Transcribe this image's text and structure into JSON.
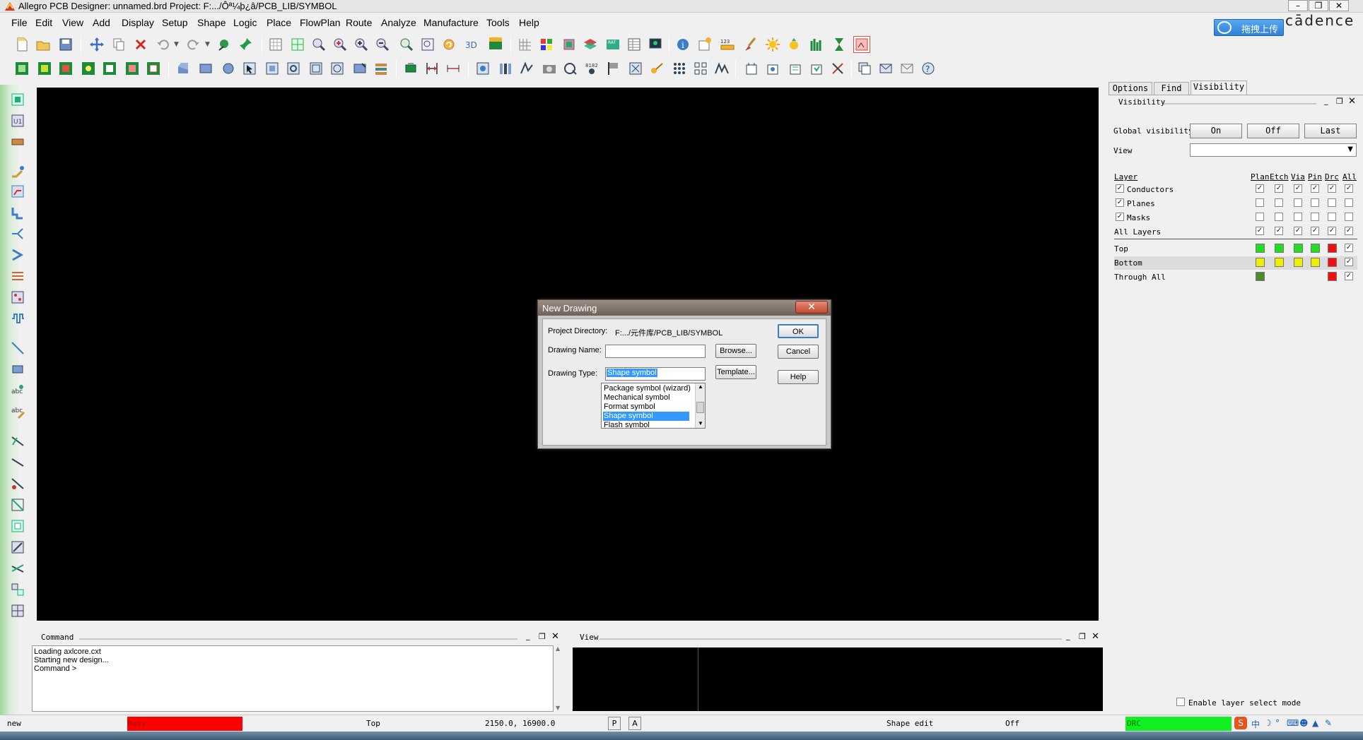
{
  "window": {
    "title": "Allegro PCB Designer: unnamed.brd  Project: F:.../Ôª¼þ¿â/PCB_LIB/SYMBOL",
    "brand": "cādence",
    "upload_label": "拖拽上传"
  },
  "menu": [
    "File",
    "Edit",
    "View",
    "Add",
    "Display",
    "Setup",
    "Shape",
    "Logic",
    "Place",
    "FlowPlan",
    "Route",
    "Analyze",
    "Manufacture",
    "Tools",
    "Help"
  ],
  "dialog": {
    "title": "New Drawing",
    "close_label": "✕",
    "project_directory_label": "Project Directory:",
    "project_directory_value": "F:.../元件库/PCB_LIB/SYMBOL",
    "drawing_name_label": "Drawing Name:",
    "drawing_name_value": "",
    "drawing_type_label": "Drawing Type:",
    "drawing_type_value": "Shape symbol",
    "drawing_type_options": [
      "Package symbol (wizard)",
      "Mechanical symbol",
      "Format symbol",
      "Shape symbol",
      "Flash symbol"
    ],
    "ok_label": "OK",
    "cancel_label": "Cancel",
    "help_label": "Help",
    "browse_label": "Browse...",
    "template_label": "Template..."
  },
  "right_panel": {
    "tabs": [
      "Options",
      "Find",
      "Visibility"
    ],
    "active_tab": "Visibility",
    "section_title": "Visibility",
    "global_visibility_label": "Global visibility",
    "on_label": "On",
    "off_label": "Off",
    "last_label": "Last",
    "view_label": "View",
    "columns": [
      "Layer",
      "Plan",
      "Etch",
      "Via",
      "Pin",
      "Drc",
      "All"
    ],
    "group_rows": [
      {
        "name": "Conductors",
        "checked": true,
        "cols": [
          true,
          true,
          true,
          true,
          true,
          true
        ]
      },
      {
        "name": "Planes",
        "checked": true,
        "cols": [
          false,
          false,
          false,
          false,
          false,
          false
        ]
      },
      {
        "name": "Masks",
        "checked": true,
        "cols": [
          false,
          false,
          false,
          false,
          false,
          false
        ]
      },
      {
        "name": "All Layers",
        "checked": false,
        "cols": [
          true,
          true,
          true,
          true,
          true,
          true
        ]
      }
    ],
    "layer_rows": [
      {
        "name": "Top",
        "colors": [
          "#22dd22",
          "#22dd22",
          "#22dd22",
          "#22dd22",
          "#ee1111"
        ],
        "all": true
      },
      {
        "name": "Bottom",
        "colors": [
          "#eeee00",
          "#eeee00",
          "#eeee00",
          "#eeee00",
          "#ee1111"
        ],
        "all": true
      },
      {
        "name": "Through All",
        "colors": [
          "#4d8a2e",
          "",
          "",
          "",
          "#ee1111"
        ],
        "all": true
      }
    ],
    "enable_layer_select_label": "Enable layer select mode"
  },
  "command": {
    "title": "Command",
    "lines": [
      "Loading axlcore.cxt",
      "Starting new design...",
      "Command >"
    ]
  },
  "view_panel": {
    "title": "View"
  },
  "status": {
    "left": "new",
    "busy": "Busy",
    "layer": "Top",
    "coords": "2150.0,  16900.0",
    "p_btn": "P",
    "a_btn": "A",
    "mode": "Shape edit",
    "off": "Off",
    "drc": "DRC"
  },
  "colors": {
    "canvas": "#000000",
    "busy": "#ff0000",
    "drc": "#11ee22",
    "selection": "#3399ff"
  }
}
